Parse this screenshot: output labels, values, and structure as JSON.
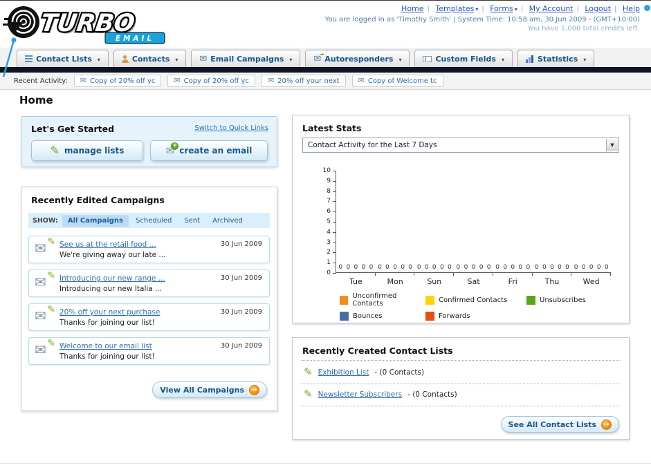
{
  "header": {
    "logo": {
      "title": "TURBO",
      "subtitle": "EMAIL"
    },
    "links": [
      "Home",
      "Templates",
      "Forms",
      "My Account",
      "Logout",
      "Help"
    ],
    "session_line": "You are logged in as 'Timothy Smith' | System Time: 10:58 am, 30 Jun 2009 - (GMT+10:00)",
    "credits_line": "You have 1,000 total credits left."
  },
  "nav": {
    "tabs": [
      {
        "label": "Contact Lists"
      },
      {
        "label": "Contacts"
      },
      {
        "label": "Email Campaigns"
      },
      {
        "label": "Autoresponders"
      },
      {
        "label": "Custom Fields"
      },
      {
        "label": "Statistics"
      }
    ]
  },
  "recent_activity": {
    "label": "Recent Activity:",
    "items": [
      {
        "label": "Copy of 20% off yc"
      },
      {
        "label": "Copy of 20% off yc"
      },
      {
        "label": "20% off your next"
      },
      {
        "label": "Copy of Welcome tc"
      }
    ]
  },
  "page": {
    "title": "Home"
  },
  "get_started": {
    "title": "Let's Get Started",
    "switch_link": "Switch to Quick Links",
    "manage_lists_button": "manage lists",
    "create_email_button": "create an email"
  },
  "campaigns": {
    "title": "Recently Edited Campaigns",
    "show_label": "SHOW:",
    "filters": [
      {
        "label": "All Campaigns",
        "selected": true
      },
      {
        "label": "Scheduled",
        "selected": false
      },
      {
        "label": "Sent",
        "selected": false
      },
      {
        "label": "Archived",
        "selected": false
      }
    ],
    "items": [
      {
        "title": "See us at the retail food ...",
        "subtitle": "We're giving away our late ...",
        "date": "30 Jun 2009"
      },
      {
        "title": "Introducing our new range ...",
        "subtitle": "Introducing our new Italia ...",
        "date": "30 Jun 2009"
      },
      {
        "title": "20% off your next purchase",
        "subtitle": "Thanks for joining our list!",
        "date": "30 Jun 2009"
      },
      {
        "title": "Welcome to our email list",
        "subtitle": "Thanks for joining our list!",
        "date": "30 Jun 2009"
      }
    ],
    "view_all_button": "View All Campaigns"
  },
  "stats": {
    "title": "Latest Stats",
    "dropdown_value": "Contact Activity for the Last 7 Days"
  },
  "chart_data": {
    "type": "bar",
    "title": "Contact Activity for the Last 7 Days",
    "categories": [
      "Tue",
      "Mon",
      "Sun",
      "Sat",
      "Fri",
      "Thu",
      "Wed"
    ],
    "series": [
      {
        "name": "Unconfirmed Contacts",
        "color": "#f6891f",
        "values": [
          0,
          0,
          0,
          0,
          0,
          0,
          0
        ]
      },
      {
        "name": "Confirmed Contacts",
        "color": "#ffd400",
        "values": [
          0,
          0,
          0,
          0,
          0,
          0,
          0
        ]
      },
      {
        "name": "Unsubscribes",
        "color": "#58a618",
        "values": [
          0,
          0,
          0,
          0,
          0,
          0,
          0
        ]
      },
      {
        "name": "Bounces",
        "color": "#4a6ea9",
        "values": [
          0,
          0,
          0,
          0,
          0,
          0,
          0
        ]
      },
      {
        "name": "Forwards",
        "color": "#e44f13",
        "values": [
          0,
          0,
          0,
          0,
          0,
          0,
          0
        ]
      }
    ],
    "ylim": [
      0,
      10
    ],
    "ytick_step": 1,
    "grid": false,
    "legend_position": "bottom"
  },
  "contact_lists": {
    "title": "Recently Created Contact Lists",
    "items": [
      {
        "name": "Exhibition List",
        "count": "- (0 Contacts)"
      },
      {
        "name": "Newsletter Subscribers",
        "count": "- (0 Contacts)"
      }
    ],
    "see_all_button": "See All Contact Lists"
  }
}
